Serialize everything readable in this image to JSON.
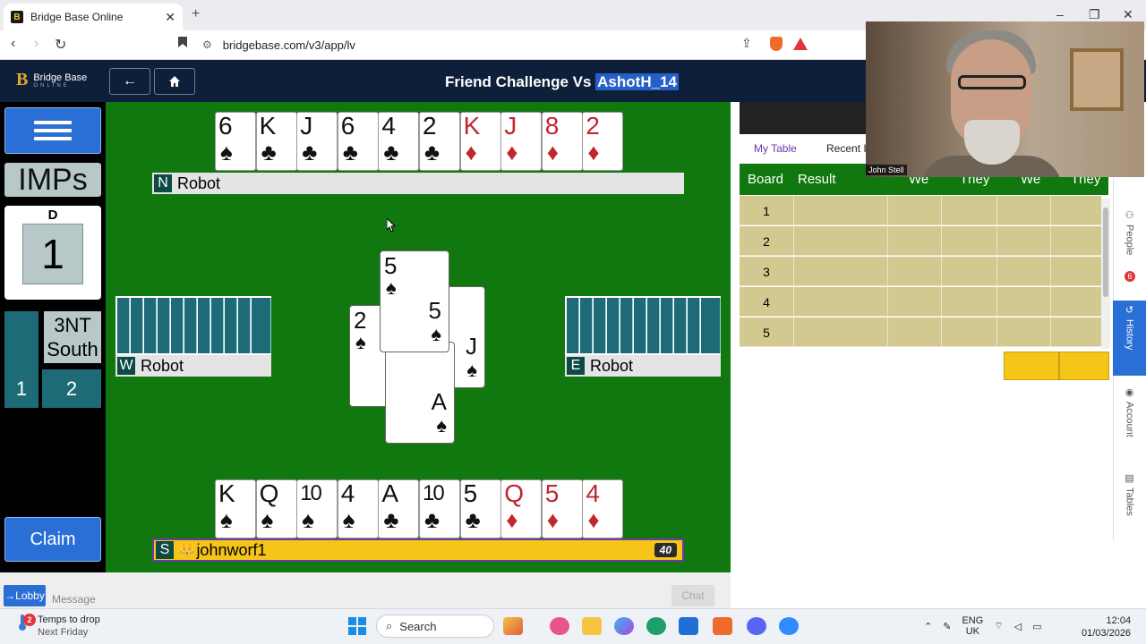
{
  "browser": {
    "tab_title": "Bridge Base Online",
    "tab_favicon": "B",
    "tab_close": "✕",
    "new_tab": "+",
    "url": "bridgebase.com/v3/app/lv",
    "window_controls": [
      "–",
      "❐",
      "✕"
    ]
  },
  "app": {
    "logo_mark": "B",
    "logo_line1": "Bridge Base",
    "logo_line2": "ONLINE",
    "title_prefix": "Friend Challenge Vs ",
    "title_opponent": "AshotH_14"
  },
  "left_panel": {
    "scoring": "IMPs",
    "dealer_label": "D",
    "board_number": "1",
    "contract_line1": "3NT",
    "contract_line2": "South",
    "tricks_ns": "1",
    "tricks_ew": "2",
    "claim_label": "Claim"
  },
  "table": {
    "north": {
      "dir": "N",
      "name": "Robot",
      "cards": [
        {
          "rank": "6",
          "suit": "♠",
          "color": "black"
        },
        {
          "rank": "K",
          "suit": "♣",
          "color": "black"
        },
        {
          "rank": "J",
          "suit": "♣",
          "color": "black"
        },
        {
          "rank": "6",
          "suit": "♣",
          "color": "black"
        },
        {
          "rank": "4",
          "suit": "♣",
          "color": "black"
        },
        {
          "rank": "2",
          "suit": "♣",
          "color": "black"
        },
        {
          "rank": "K",
          "suit": "♦",
          "color": "red"
        },
        {
          "rank": "J",
          "suit": "♦",
          "color": "red"
        },
        {
          "rank": "8",
          "suit": "♦",
          "color": "red"
        },
        {
          "rank": "2",
          "suit": "♦",
          "color": "red"
        }
      ]
    },
    "west": {
      "dir": "W",
      "name": "Robot"
    },
    "east": {
      "dir": "E",
      "name": "Robot"
    },
    "south": {
      "dir": "S",
      "name": "johnworf1",
      "crown_icon": "👑",
      "score": "40",
      "cards": [
        {
          "rank": "K",
          "suit": "♠",
          "color": "black"
        },
        {
          "rank": "Q",
          "suit": "♠",
          "color": "black"
        },
        {
          "rank": "10",
          "suit": "♠",
          "color": "black"
        },
        {
          "rank": "4",
          "suit": "♠",
          "color": "black"
        },
        {
          "rank": "A",
          "suit": "♣",
          "color": "black"
        },
        {
          "rank": "10",
          "suit": "♣",
          "color": "black"
        },
        {
          "rank": "5",
          "suit": "♣",
          "color": "black"
        },
        {
          "rank": "Q",
          "suit": "♦",
          "color": "red"
        },
        {
          "rank": "5",
          "suit": "♦",
          "color": "red"
        },
        {
          "rank": "4",
          "suit": "♦",
          "color": "red"
        }
      ]
    },
    "trick": {
      "north_card": {
        "rank": "5",
        "suit": "♠"
      },
      "west_card": {
        "rank": "2",
        "suit": "♠"
      },
      "east_card": {
        "rank": "J",
        "suit": "♠"
      },
      "south_card": {
        "rank": "A",
        "suit": "♠"
      }
    }
  },
  "chat": {
    "lobby_label": "→Lobby",
    "message_placeholder": "Message",
    "chat_button": "Chat"
  },
  "right_panel": {
    "tabs": [
      "My Table",
      "Recent I"
    ],
    "headers": [
      "Board",
      "Result",
      "We",
      "They",
      "We",
      "They"
    ],
    "rows": [
      "1",
      "2",
      "3",
      "4",
      "5"
    ]
  },
  "side_tabs": [
    {
      "label": "People",
      "icon": "people-icon",
      "badge": "6"
    },
    {
      "label": "History",
      "icon": "history-icon"
    },
    {
      "label": "Account",
      "icon": "account-icon"
    },
    {
      "label": "Tables",
      "icon": "tables-icon"
    }
  ],
  "webcam": {
    "name": "John Stell"
  },
  "taskbar": {
    "weather_line1": "Temps to drop",
    "weather_line2": "Next Friday",
    "weather_badge": "2",
    "search_label": "Search",
    "lang_line1": "ENG",
    "lang_line2": "UK",
    "time": "12:04",
    "date": "01/03/2026"
  },
  "colors": {
    "felt": "#10780f",
    "header": "#0e1f3a",
    "accent_blue": "#2a6fd6",
    "red_suit": "#c0262f",
    "south_plate": "#f5c518"
  }
}
